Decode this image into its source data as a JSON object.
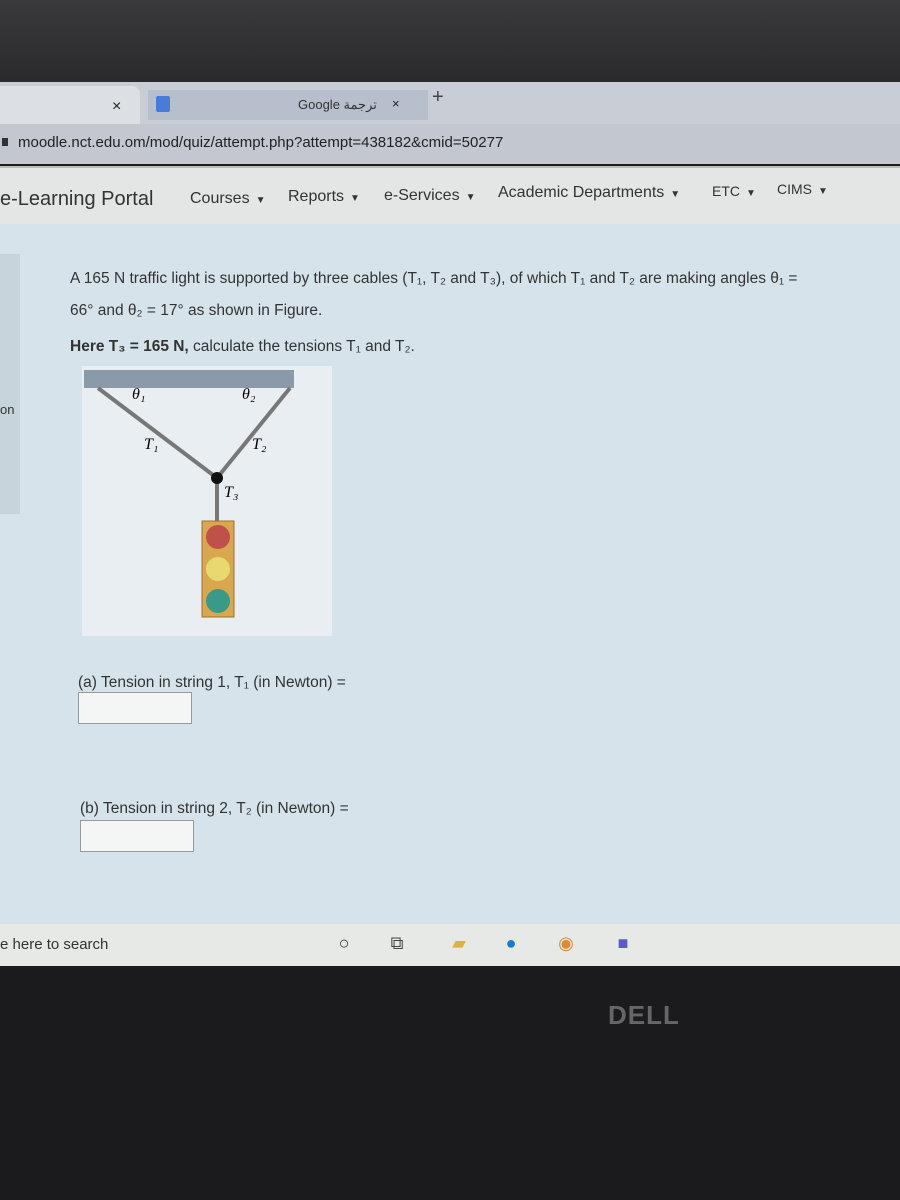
{
  "browser": {
    "tabs": [
      {
        "label": "",
        "close": "×"
      },
      {
        "label": "Google ترجمة",
        "close": "×"
      }
    ],
    "new_tab": "+",
    "url": "moodle.nct.edu.om/mod/quiz/attempt.php?attempt=438182&cmid=50277"
  },
  "nav": {
    "brand": "e-Learning Portal",
    "items": [
      {
        "label": "Courses"
      },
      {
        "label": "Reports"
      },
      {
        "label": "e-Services"
      },
      {
        "label": "Academic Departments"
      },
      {
        "label": "ETC"
      },
      {
        "label": "CIMS"
      }
    ],
    "caret": "▼"
  },
  "sidebar_fragment": "on",
  "question": {
    "line1": "A 165 N traffic light is supported by three cables (T₁, T₂ and T₃), of which T₁ and T₂ are making angles θ₁ =",
    "line2": "66° and θ₂ = 17° as shown in Figure.",
    "line3_bold": "Here T₃ = 165 N,",
    "line3_rest": " calculate the tensions T₁ and T₂.",
    "figure": {
      "theta1": "θ₁",
      "theta2": "θ₂",
      "t1": "T₁",
      "t2": "T₂",
      "t3": "T₃"
    },
    "part_a": {
      "label": "(a) Tension in string 1, T₁ (in Newton) =",
      "value": ""
    },
    "part_b": {
      "label": "(b) Tension in string 2, T₂ (in Newton) =",
      "value": ""
    }
  },
  "taskbar": {
    "search": "e here to search",
    "icons": [
      "cortana-icon",
      "task-view-icon",
      "file-explorer-icon",
      "edge-icon",
      "chrome-icon",
      "teams-icon"
    ]
  },
  "laptop_brand": "DELL"
}
